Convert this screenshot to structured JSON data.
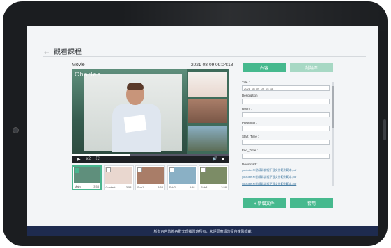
{
  "page": {
    "back_arrow": "←",
    "title": "觀看課程",
    "movie_label": "Movie",
    "timestamp": "2021-08-09  09:04:18",
    "brand_text": "Charles"
  },
  "player": {
    "play_icon": "▶",
    "speed": "x2",
    "fullscreen_icon": "⛶",
    "volume_icon": "🔊",
    "progress": 0.37
  },
  "thumbnails": [
    {
      "caption": "Main",
      "duration": "3:58",
      "selected": true,
      "color": "#5f8f7c"
    },
    {
      "caption": "Content",
      "duration": "3:58",
      "selected": false,
      "color": "#e9d7cf"
    },
    {
      "caption": "Sub1",
      "duration": "3:58",
      "selected": false,
      "color": "#a97d68"
    },
    {
      "caption": "Sub2",
      "duration": "3:58",
      "selected": false,
      "color": "#8ab0c5"
    },
    {
      "caption": "Sub3",
      "duration": "3:58",
      "selected": false,
      "color": "#7c8c66"
    }
  ],
  "tabs": {
    "active": "內容",
    "inactive": "討論區"
  },
  "form": {
    "title_label": "Title :",
    "title_value": "2021_08_09_09_04_18",
    "description_label": "Description :",
    "description_value": "",
    "room_label": "Room :",
    "room_value": "",
    "presenter_label": "Presenter :",
    "presenter_value": "",
    "start_label": "Start_Time :",
    "start_value": "",
    "end_label": "End_Time :",
    "end_value": "",
    "download_label": "Download :",
    "downloads": [
      "youtube-布動精彩課程下載文件範例範本.pdf",
      "youtube-布動精彩課程下載文件範例範本.pdf",
      "youtube-布動精彩課程下載文件範例範本.pdf"
    ]
  },
  "buttons": {
    "add_file": "+ 新增文件",
    "apply": "套用"
  },
  "footer": "所有內容皆為各數文理補習班所有，未經同意請勿擅自複製轉載",
  "colors": {
    "accent": "#46b98e",
    "accent_light": "#a7d8c4",
    "footer": "#1e2b4f",
    "bezel": "#1b1d20"
  }
}
